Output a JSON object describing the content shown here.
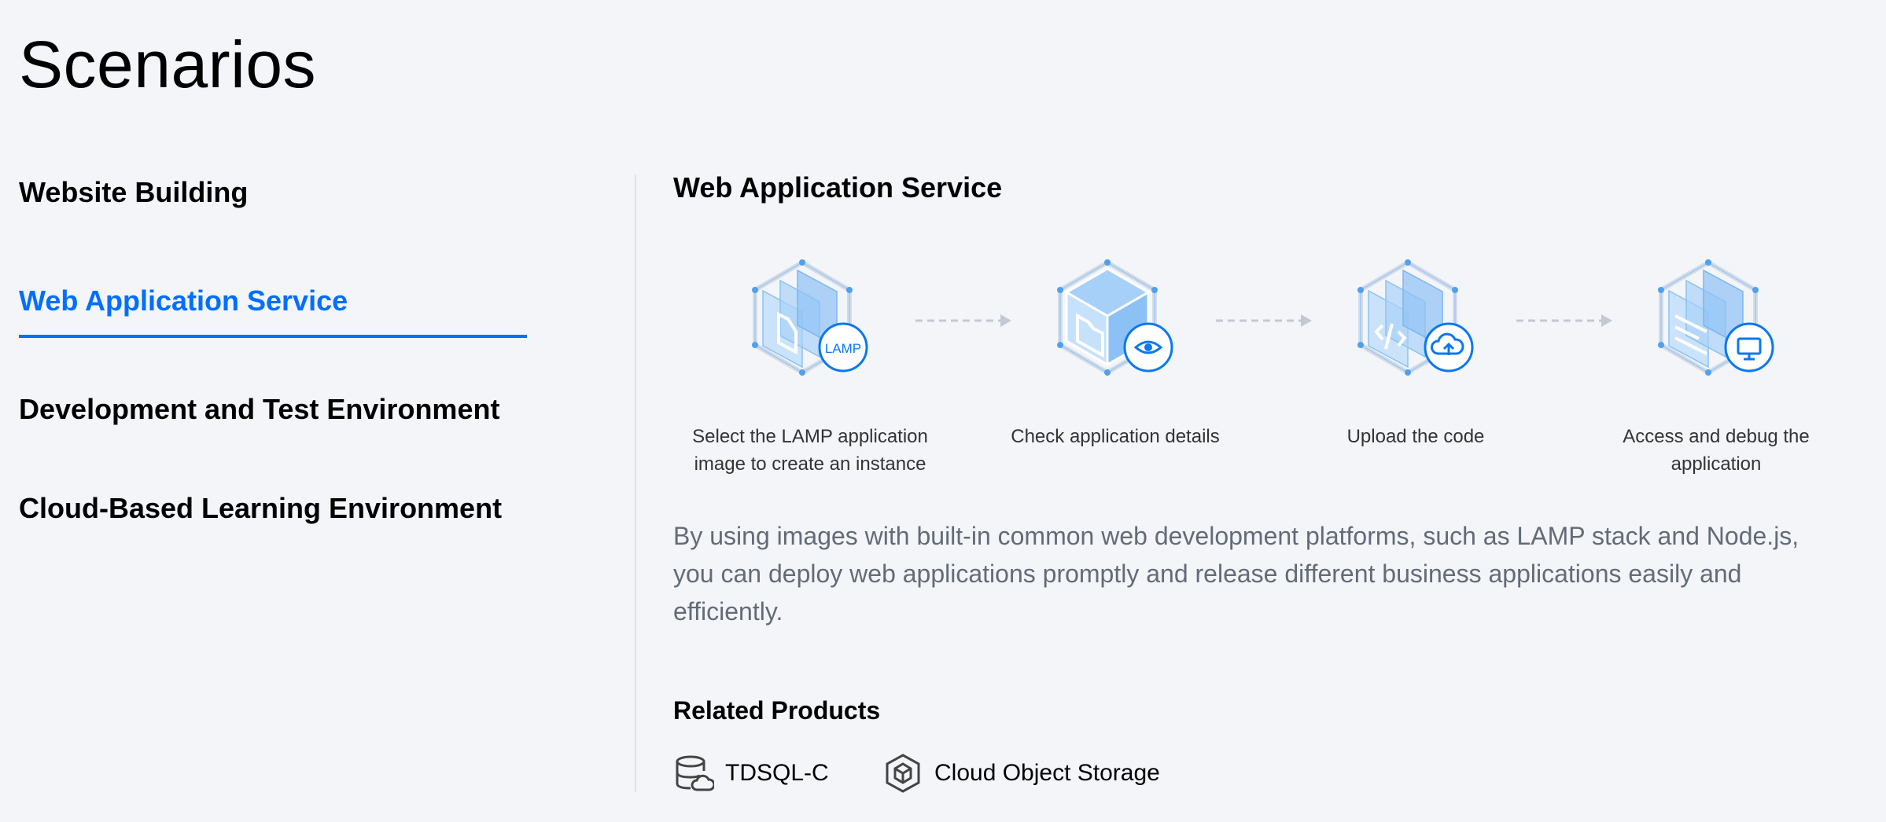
{
  "page": {
    "title": "Scenarios"
  },
  "tabs": [
    {
      "label": "Website Building"
    },
    {
      "label": "Web Application Service"
    },
    {
      "label": "Development and Test Environment"
    },
    {
      "label": "Cloud-Based Learning Environment"
    }
  ],
  "active_tab": "Web Application Service",
  "panel": {
    "title": "Web Application Service",
    "steps": [
      {
        "label": "Select the LAMP application image to create an instance",
        "badge": "LAMP",
        "icon": "lamp-cube-icon"
      },
      {
        "label": "Check application details",
        "icon": "eye-cube-icon"
      },
      {
        "label": "Upload the code",
        "icon": "cloud-upload-cube-icon"
      },
      {
        "label": "Access and debug the application",
        "icon": "monitor-cube-icon"
      }
    ],
    "description": "By using images with built-in common web development platforms, such as LAMP stack and Node.js, you can deploy web applications promptly and release different business applications easily and efficiently.",
    "related_title": "Related Products",
    "products": [
      {
        "label": "TDSQL-C",
        "icon": "database-cloud-icon"
      },
      {
        "label": "Cloud Object Storage",
        "icon": "storage-box-icon"
      }
    ]
  },
  "colors": {
    "accent": "#006eff",
    "background": "#f3f5f9",
    "muted_text": "#646b77",
    "divider": "#dde1e8"
  }
}
